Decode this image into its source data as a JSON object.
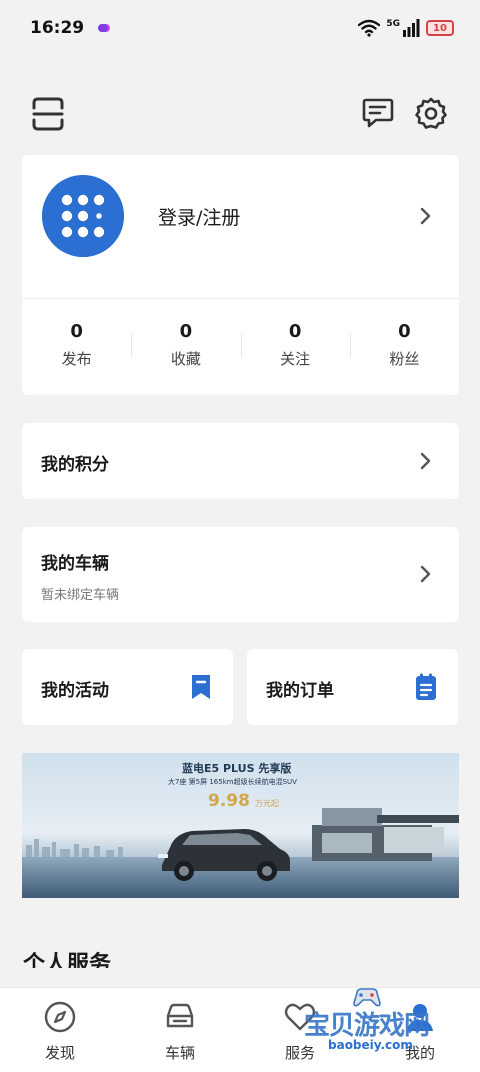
{
  "status_bar": {
    "time": "16:29",
    "network": "5G",
    "battery": "10",
    "icons": [
      "notification-dot-icon",
      "wifi-icon",
      "signal-icon",
      "battery-icon"
    ]
  },
  "header": {
    "icons": [
      "scan-icon",
      "message-icon",
      "settings-icon"
    ]
  },
  "profile": {
    "login_label": "登录/注册",
    "stats": [
      {
        "value": "0",
        "label": "发布"
      },
      {
        "value": "0",
        "label": "收藏"
      },
      {
        "value": "0",
        "label": "关注"
      },
      {
        "value": "0",
        "label": "粉丝"
      }
    ]
  },
  "points": {
    "title": "我的积分"
  },
  "vehicle": {
    "title": "我的车辆",
    "subtitle": "暂未绑定车辆"
  },
  "activity": {
    "title": "我的活动"
  },
  "orders": {
    "title": "我的订单"
  },
  "banner": {
    "title": "蓝电E5 PLUS 先享版",
    "tagline": "大7座 第5屏 165km超级长续航电混SUV",
    "price": "9.98",
    "price_unit": "万元起"
  },
  "section": {
    "title": "个人服务"
  },
  "bottom_nav": [
    {
      "label": "发现",
      "icon": "compass-icon"
    },
    {
      "label": "车辆",
      "icon": "car-icon"
    },
    {
      "label": "服务",
      "icon": "heart-icon"
    },
    {
      "label": "我的",
      "icon": "person-icon"
    }
  ],
  "watermark": {
    "text": "宝贝游戏网",
    "url": "baobeiy.com"
  },
  "colors": {
    "accent": "#2a6fd1",
    "background": "#f2f2f2",
    "card": "#ffffff",
    "battery_low": "#d94040"
  }
}
